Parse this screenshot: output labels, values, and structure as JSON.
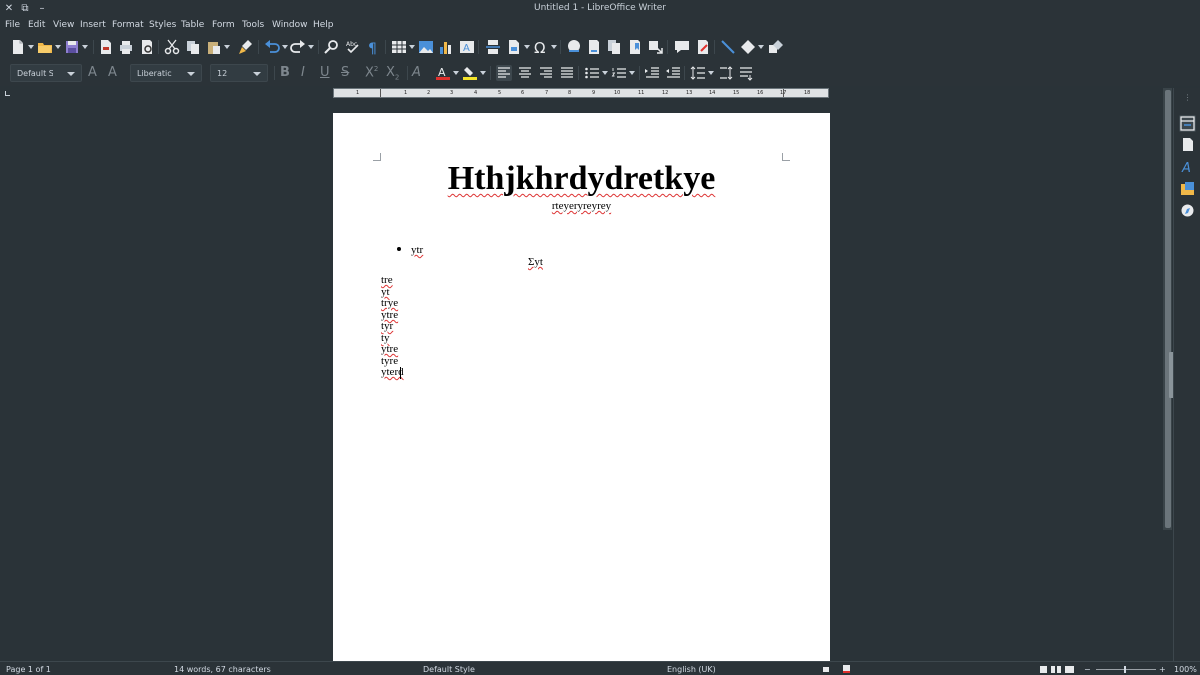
{
  "window": {
    "title": "Untitled 1 - LibreOffice Writer"
  },
  "menu": [
    "File",
    "Edit",
    "View",
    "Insert",
    "Format",
    "Styles",
    "Table",
    "Form",
    "Tools",
    "Window",
    "Help"
  ],
  "format_toolbar": {
    "paragraph_style": "Default S",
    "font_name": "Liberatic",
    "font_size": "12"
  },
  "ruler": {
    "numbers": [
      "1",
      "1",
      "2",
      "3",
      "4",
      "5",
      "6",
      "7",
      "8",
      "9",
      "10",
      "11",
      "12",
      "13",
      "14",
      "15",
      "16",
      "17",
      "18"
    ]
  },
  "document": {
    "title": "Hthjkhrdydretkye",
    "subtitle": "rteyeryreyrey",
    "bullet_text": "ytr",
    "centered_text": "Σyt",
    "lines": [
      "tre",
      "yt",
      "trye",
      "ytre",
      "tyr",
      "ty",
      "ytre",
      "tyre",
      "yterd"
    ]
  },
  "status": {
    "page": "Page 1 of 1",
    "word_count": "14 words, 67 characters",
    "page_style": "Default Style",
    "language": "English (UK)",
    "zoom": "100%"
  },
  "colors": {
    "chrome": "#2b3338",
    "workspace": "#2a3338",
    "font_color_bar": "#e0302d",
    "highlight_bar": "#f5e52a",
    "accent": "#4a90d9"
  }
}
